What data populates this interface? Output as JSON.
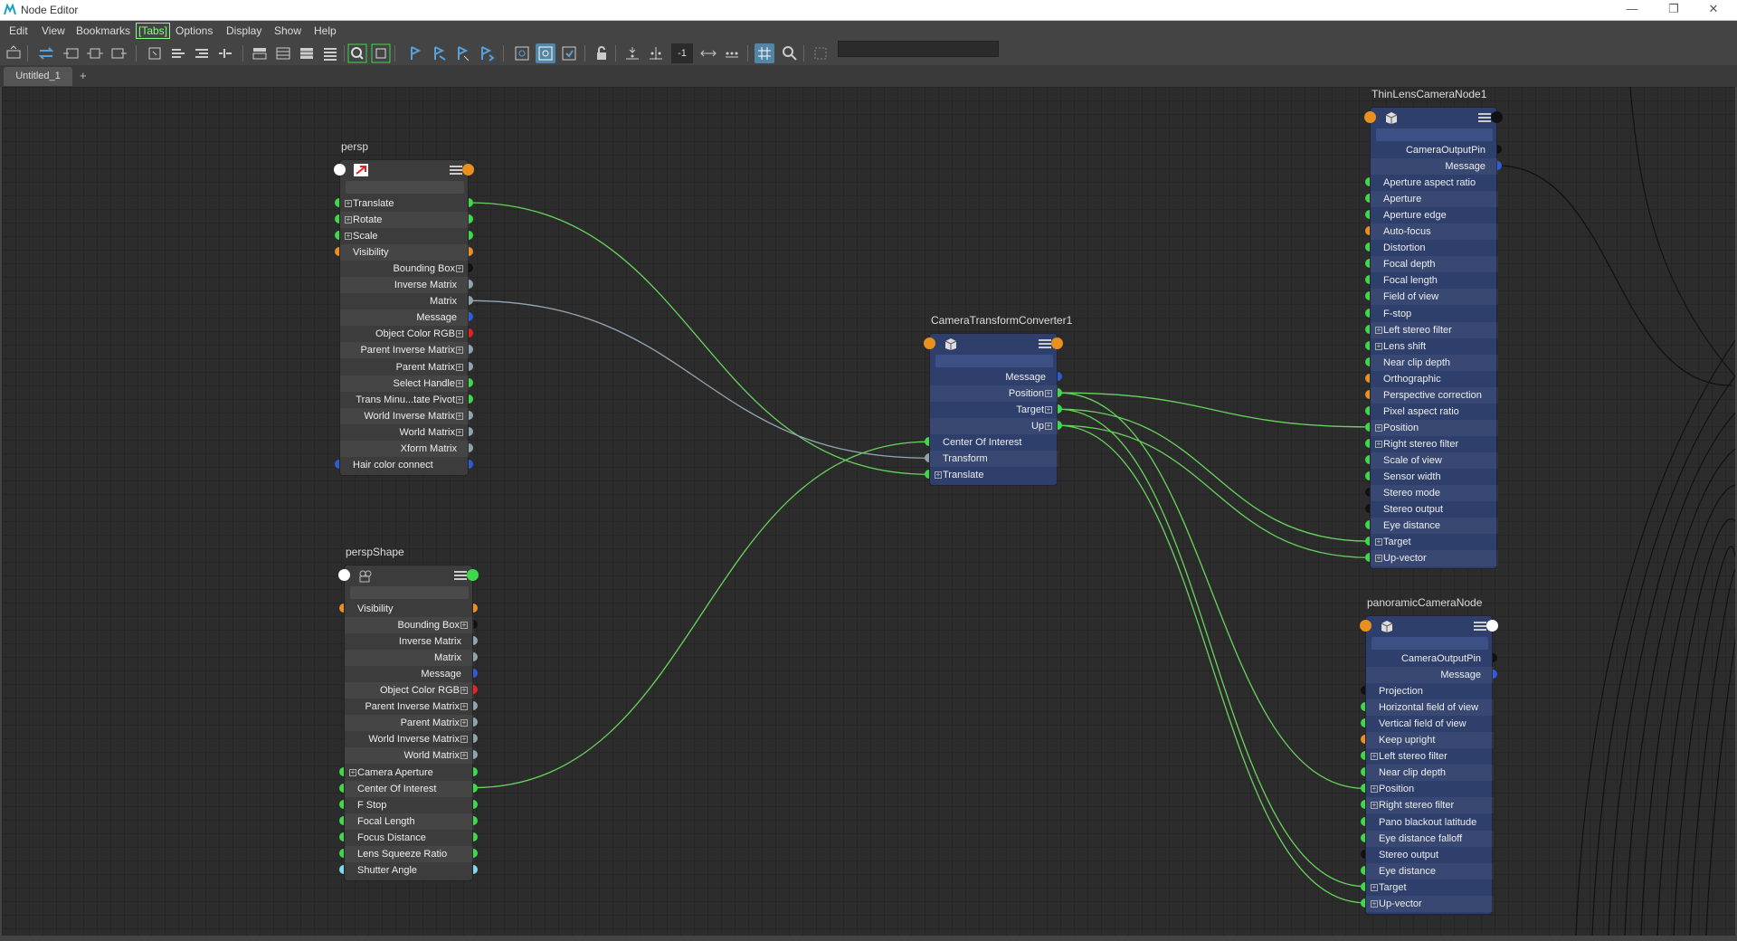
{
  "window": {
    "title": "Node Editor"
  },
  "menu": [
    "Edit",
    "View",
    "Bookmarks",
    "[Tabs]",
    "Options",
    "Display",
    "Show",
    "Help"
  ],
  "toolbar": {
    "zoom_value": "-1",
    "search_value": ""
  },
  "tabs": [
    {
      "label": "Untitled_1"
    }
  ],
  "add_tab_label": "+",
  "colors": {
    "green": "#3ed94a",
    "orange": "#e9901f",
    "blue": "#2e5bd6",
    "black": "#111111",
    "red": "#e52222",
    "grey": "#8fa3ad",
    "white": "#ffffff",
    "cyan": "#7fd8ec",
    "wire_green": "#67d45c",
    "wire_grey": "#93a7b4"
  },
  "nodes": [
    {
      "id": "persp",
      "title": "persp",
      "style": "grey",
      "icon": "transform-icon",
      "in_port": "white",
      "out_port": "orange",
      "attributes": [
        {
          "label": "Translate",
          "side": "left",
          "plus": true,
          "in": "green",
          "out": "green"
        },
        {
          "label": "Rotate",
          "side": "left",
          "plus": true,
          "in": "green",
          "out": "green"
        },
        {
          "label": "Scale",
          "side": "left",
          "plus": true,
          "in": "green",
          "out": "green"
        },
        {
          "label": "Visibility",
          "side": "left",
          "plus": false,
          "in": "orange",
          "out": "orange"
        },
        {
          "label": "Bounding Box",
          "side": "right",
          "plus": true,
          "out": "black"
        },
        {
          "label": "Inverse Matrix",
          "side": "right",
          "plus": false,
          "out": "grey"
        },
        {
          "label": "Matrix",
          "side": "right",
          "plus": false,
          "out": "grey"
        },
        {
          "label": "Message",
          "side": "right",
          "plus": false,
          "out": "blue"
        },
        {
          "label": "Object Color RGB",
          "side": "right",
          "plus": true,
          "out": "red"
        },
        {
          "label": "Parent Inverse Matrix",
          "side": "right",
          "plus": true,
          "out": "grey"
        },
        {
          "label": "Parent Matrix",
          "side": "right",
          "plus": true,
          "out": "grey"
        },
        {
          "label": "Select Handle",
          "side": "right",
          "plus": true,
          "out": "green"
        },
        {
          "label": "Trans Minu...tate Pivot",
          "side": "right",
          "plus": true,
          "out": "green"
        },
        {
          "label": "World Inverse Matrix",
          "side": "right",
          "plus": true,
          "out": "grey"
        },
        {
          "label": "World Matrix",
          "side": "right",
          "plus": true,
          "out": "grey"
        },
        {
          "label": "Xform Matrix",
          "side": "right",
          "plus": false,
          "out": "grey"
        },
        {
          "label": "Hair color connect",
          "side": "left",
          "plus": false,
          "in": "blue",
          "out": "blue"
        }
      ]
    },
    {
      "id": "perspShape",
      "title": "perspShape",
      "style": "grey",
      "icon": "camera-shape-icon",
      "in_port": "white",
      "out_port": "green",
      "attributes": [
        {
          "label": "Visibility",
          "side": "left",
          "plus": false,
          "in": "orange",
          "out": "orange"
        },
        {
          "label": "Bounding Box",
          "side": "right",
          "plus": true,
          "out": "black"
        },
        {
          "label": "Inverse Matrix",
          "side": "right",
          "plus": false,
          "out": "grey"
        },
        {
          "label": "Matrix",
          "side": "right",
          "plus": false,
          "out": "grey"
        },
        {
          "label": "Message",
          "side": "right",
          "plus": false,
          "out": "blue"
        },
        {
          "label": "Object Color RGB",
          "side": "right",
          "plus": true,
          "out": "red"
        },
        {
          "label": "Parent Inverse Matrix",
          "side": "right",
          "plus": true,
          "out": "grey"
        },
        {
          "label": "Parent Matrix",
          "side": "right",
          "plus": true,
          "out": "grey"
        },
        {
          "label": "World Inverse Matrix",
          "side": "right",
          "plus": true,
          "out": "grey"
        },
        {
          "label": "World Matrix",
          "side": "right",
          "plus": true,
          "out": "grey"
        },
        {
          "label": "Camera Aperture",
          "side": "left",
          "plus": true,
          "in": "green",
          "out": "green"
        },
        {
          "label": "Center Of Interest",
          "side": "left",
          "plus": false,
          "in": "green",
          "out": "green"
        },
        {
          "label": "F Stop",
          "side": "left",
          "plus": false,
          "in": "green",
          "out": "green"
        },
        {
          "label": "Focal Length",
          "side": "left",
          "plus": false,
          "in": "green",
          "out": "green"
        },
        {
          "label": "Focus Distance",
          "side": "left",
          "plus": false,
          "in": "green",
          "out": "green"
        },
        {
          "label": "Lens Squeeze Ratio",
          "side": "left",
          "plus": false,
          "in": "green",
          "out": "green"
        },
        {
          "label": "Shutter Angle",
          "side": "left",
          "plus": false,
          "in": "cyan",
          "out": "cyan"
        }
      ]
    },
    {
      "id": "ctc",
      "title": "CameraTransformConverter1",
      "style": "blue",
      "icon": "box-icon",
      "in_port": "orange",
      "out_port": "orange",
      "attributes": [
        {
          "label": "Message",
          "side": "right",
          "plus": false,
          "out": "blue"
        },
        {
          "label": "Position",
          "side": "right",
          "plus": true,
          "out": "green"
        },
        {
          "label": "Target",
          "side": "right",
          "plus": true,
          "out": "green"
        },
        {
          "label": "Up",
          "side": "right",
          "plus": true,
          "out": "green"
        },
        {
          "label": "Center Of Interest",
          "side": "left",
          "plus": false,
          "in": "green"
        },
        {
          "label": "Transform",
          "side": "left",
          "plus": false,
          "in": "grey"
        },
        {
          "label": "Translate",
          "side": "left",
          "plus": true,
          "in": "green"
        }
      ]
    },
    {
      "id": "thinlens",
      "title": "ThinLensCameraNode1",
      "style": "blue",
      "icon": "box-icon",
      "in_port": "orange",
      "out_port": "black",
      "attributes": [
        {
          "label": "CameraOutputPin",
          "side": "right",
          "plus": false,
          "out": "black"
        },
        {
          "label": "Message",
          "side": "right",
          "plus": false,
          "out": "blue"
        },
        {
          "label": "Aperture aspect ratio",
          "side": "left",
          "plus": false,
          "in": "green"
        },
        {
          "label": "Aperture",
          "side": "left",
          "plus": false,
          "in": "green"
        },
        {
          "label": "Aperture edge",
          "side": "left",
          "plus": false,
          "in": "green"
        },
        {
          "label": "Auto-focus",
          "side": "left",
          "plus": false,
          "in": "orange"
        },
        {
          "label": "Distortion",
          "side": "left",
          "plus": false,
          "in": "green"
        },
        {
          "label": "Focal depth",
          "side": "left",
          "plus": false,
          "in": "green"
        },
        {
          "label": "Focal length",
          "side": "left",
          "plus": false,
          "in": "green"
        },
        {
          "label": "Field of view",
          "side": "left",
          "plus": false,
          "in": "green"
        },
        {
          "label": "F-stop",
          "side": "left",
          "plus": false,
          "in": "green"
        },
        {
          "label": "Left stereo filter",
          "side": "left",
          "plus": true,
          "in": "green"
        },
        {
          "label": "Lens shift",
          "side": "left",
          "plus": true,
          "in": "green"
        },
        {
          "label": "Near clip depth",
          "side": "left",
          "plus": false,
          "in": "green"
        },
        {
          "label": "Orthographic",
          "side": "left",
          "plus": false,
          "in": "orange"
        },
        {
          "label": "Perspective correction",
          "side": "left",
          "plus": false,
          "in": "orange"
        },
        {
          "label": "Pixel aspect ratio",
          "side": "left",
          "plus": false,
          "in": "green"
        },
        {
          "label": "Position",
          "side": "left",
          "plus": true,
          "in": "green"
        },
        {
          "label": "Right stereo filter",
          "side": "left",
          "plus": true,
          "in": "green"
        },
        {
          "label": "Scale of view",
          "side": "left",
          "plus": false,
          "in": "green"
        },
        {
          "label": "Sensor width",
          "side": "left",
          "plus": false,
          "in": "green"
        },
        {
          "label": "Stereo mode",
          "side": "left",
          "plus": false,
          "in": "black"
        },
        {
          "label": "Stereo output",
          "side": "left",
          "plus": false,
          "in": "black"
        },
        {
          "label": "Eye distance",
          "side": "left",
          "plus": false,
          "in": "green"
        },
        {
          "label": "Target",
          "side": "left",
          "plus": true,
          "in": "green"
        },
        {
          "label": "Up-vector",
          "side": "left",
          "plus": true,
          "in": "green"
        }
      ]
    },
    {
      "id": "panoramic",
      "title": "panoramicCameraNode",
      "style": "blue",
      "icon": "box-icon",
      "in_port": "orange",
      "out_port": "white",
      "attributes": [
        {
          "label": "CameraOutputPin",
          "side": "right",
          "plus": false,
          "out": "black"
        },
        {
          "label": "Message",
          "side": "right",
          "plus": false,
          "out": "blue"
        },
        {
          "label": "Projection",
          "side": "left",
          "plus": false,
          "in": "black"
        },
        {
          "label": "Horizontal field of view",
          "side": "left",
          "plus": false,
          "in": "green"
        },
        {
          "label": "Vertical field of view",
          "side": "left",
          "plus": false,
          "in": "green"
        },
        {
          "label": "Keep upright",
          "side": "left",
          "plus": false,
          "in": "orange"
        },
        {
          "label": "Left stereo filter",
          "side": "left",
          "plus": true,
          "in": "green"
        },
        {
          "label": "Near clip depth",
          "side": "left",
          "plus": false,
          "in": "green"
        },
        {
          "label": "Position",
          "side": "left",
          "plus": true,
          "in": "green"
        },
        {
          "label": "Right stereo filter",
          "side": "left",
          "plus": true,
          "in": "green"
        },
        {
          "label": "Pano blackout latitude",
          "side": "left",
          "plus": false,
          "in": "green"
        },
        {
          "label": "Eye distance falloff",
          "side": "left",
          "plus": false,
          "in": "green"
        },
        {
          "label": "Stereo output",
          "side": "left",
          "plus": false,
          "in": "black"
        },
        {
          "label": "Eye distance",
          "side": "left",
          "plus": false,
          "in": "green"
        },
        {
          "label": "Target",
          "side": "left",
          "plus": true,
          "in": "green"
        },
        {
          "label": "Up-vector",
          "side": "left",
          "plus": true,
          "in": "green"
        }
      ]
    }
  ],
  "connections": [
    {
      "from": [
        "persp",
        "Translate"
      ],
      "to": [
        "ctc",
        "Translate"
      ],
      "color": "wire_green"
    },
    {
      "from": [
        "persp",
        "Matrix"
      ],
      "to": [
        "ctc",
        "Transform"
      ],
      "color": "wire_grey"
    },
    {
      "from": [
        "perspShape",
        "Center Of Interest"
      ],
      "to": [
        "ctc",
        "Center Of Interest"
      ],
      "color": "wire_green"
    },
    {
      "from": [
        "ctc",
        "Position"
      ],
      "to": [
        "thinlens",
        "Position"
      ],
      "color": "wire_green"
    },
    {
      "from": [
        "ctc",
        "Target"
      ],
      "to": [
        "thinlens",
        "Target"
      ],
      "color": "wire_green"
    },
    {
      "from": [
        "ctc",
        "Up"
      ],
      "to": [
        "thinlens",
        "Up-vector"
      ],
      "color": "wire_green"
    },
    {
      "from": [
        "ctc",
        "Position"
      ],
      "to": [
        "panoramic",
        "Position"
      ],
      "color": "wire_green"
    },
    {
      "from": [
        "ctc",
        "Target"
      ],
      "to": [
        "panoramic",
        "Target"
      ],
      "color": "wire_green"
    },
    {
      "from": [
        "ctc",
        "Up"
      ],
      "to": [
        "panoramic",
        "Up-vector"
      ],
      "color": "wire_green"
    },
    {
      "from": [
        "thinlens",
        "Message"
      ],
      "to": [
        "offscreen",
        ""
      ],
      "color": "wire_dark"
    }
  ]
}
